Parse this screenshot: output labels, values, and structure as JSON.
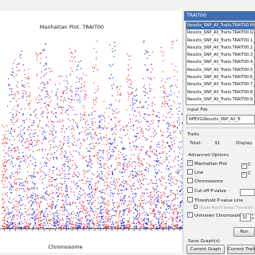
{
  "plot": {
    "title": "Manhattan Plot: TRAIT00",
    "xlabel": "Chromosome"
  },
  "chart_data": {
    "type": "scatter",
    "title": "Manhattan Plot: TRAIT00",
    "xlabel": "Chromosome",
    "series_colors": [
      "#e8141c",
      "#1212e0"
    ],
    "chromosome_count": 32
  },
  "panel": {
    "title": "TRAIT00",
    "results": [
      "Results_SNP_All_Traits.TRAIT00.Manha",
      "Results_SNP_All_Traits.TRAIT00.Q-Q",
      "Results_SNP_All_Traits.TRAIT00.1_",
      "Results_SNP_All_Traits.TRAIT00.2_",
      "Results_SNP_All_Traits.TRAIT00.3_",
      "Results_SNP_All_Traits.TRAIT00.4_",
      "Results_SNP_All_Traits.TRAIT00.5_",
      "Results_SNP_All_Traits.TRAIT00.6_",
      "Results_SNP_All_Traits.TRAIT00.7_",
      "Results_SNP_All_Traits.TRAIT00.8_",
      "Results_SNP_All_Traits.TRAIT00.9_"
    ],
    "input_file_label": "Input File",
    "input_file_value": "NPEVG\\Results_SNP_All_Tr",
    "traits_label": "Traits",
    "total_label": "Total:",
    "total_value": "31",
    "display_label": "Display",
    "advanced_label": "Advanced Options",
    "options": {
      "manhattan": "Manhattan Plot",
      "line": "Line",
      "chromosome": "Chromosome",
      "cutoff": "Cut-off P-value",
      "threshold": "Threshold P-value Line",
      "shade": "Shade Points below Threshold",
      "unknown": "Unknown Chromosome",
      "unknown_value": "32"
    },
    "run_label": "Run",
    "save_label": "Save Graph(s)",
    "current_graph": "Current Graph",
    "current_trait": "Current Trait"
  }
}
